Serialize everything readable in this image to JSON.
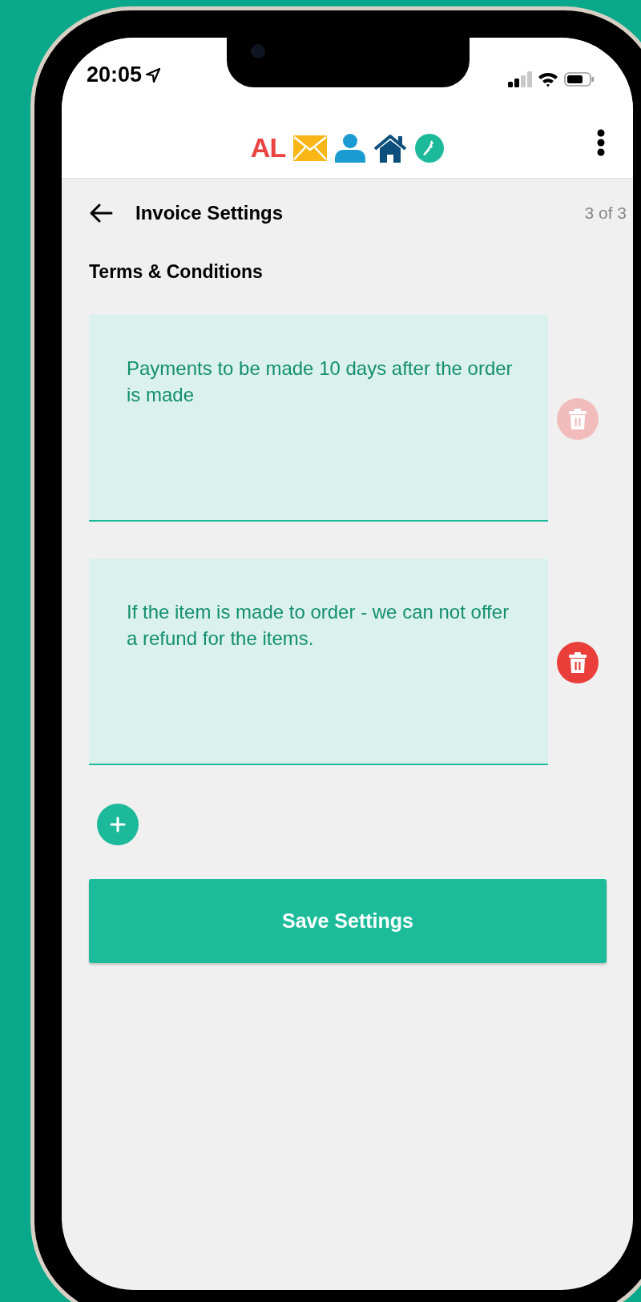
{
  "status_bar": {
    "time": "20:05"
  },
  "app_bar": {
    "logo": "AL"
  },
  "nav": {
    "title": "Invoice Settings",
    "step": "3 of 3"
  },
  "section_title": "Terms & Conditions",
  "terms": [
    {
      "value": "Payments to be made 10 days after the order is made",
      "delete_disabled": true
    },
    {
      "value": "If the item is made to order - we can not offer a refund for the items.",
      "delete_disabled": false
    }
  ],
  "save_button": "Save Settings"
}
